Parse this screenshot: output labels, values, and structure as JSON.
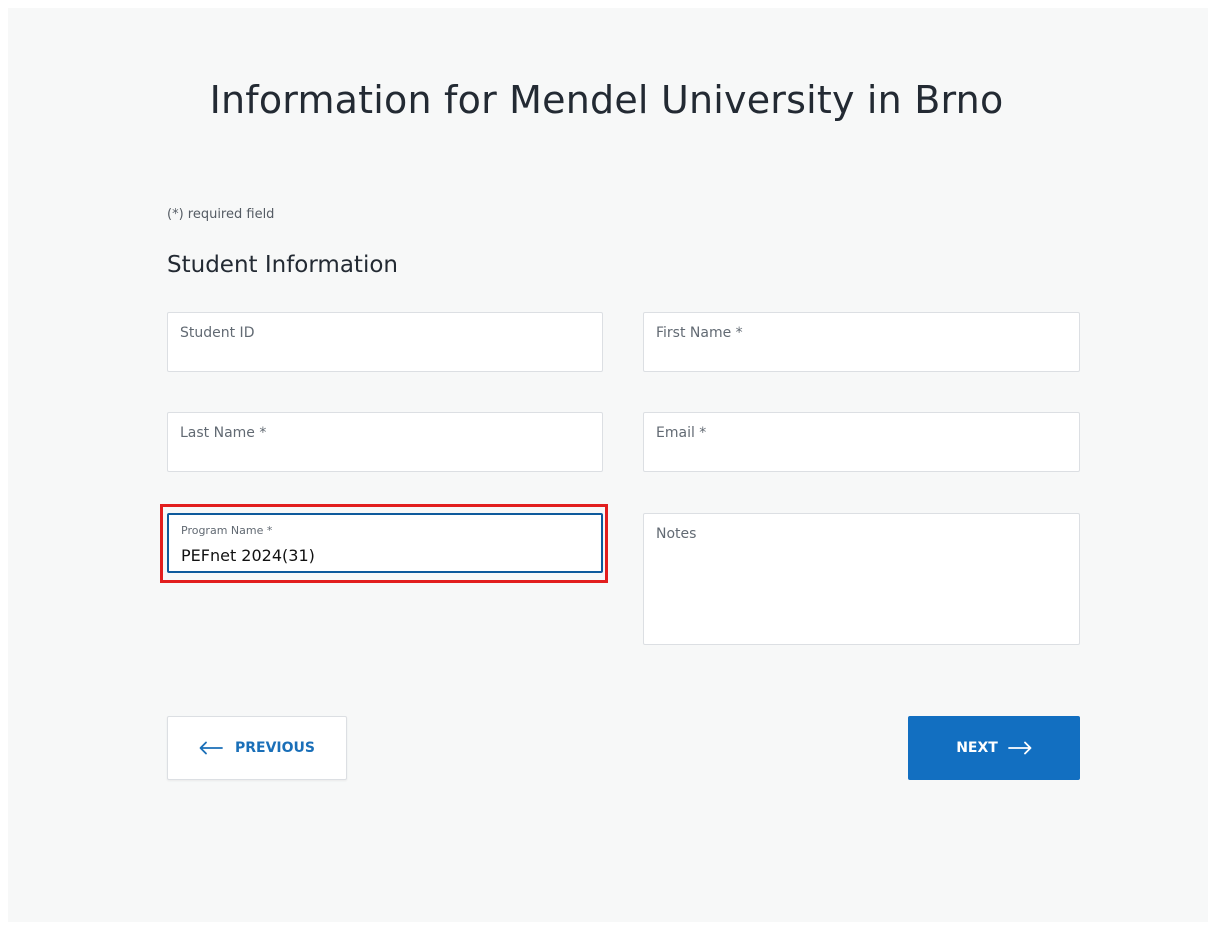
{
  "page": {
    "title": "Information for Mendel University in Brno",
    "required_note": "(*) required field",
    "section_title": "Student Information"
  },
  "fields": {
    "student_id": {
      "label": "Student ID",
      "value": ""
    },
    "first_name": {
      "label": "First Name *",
      "value": ""
    },
    "last_name": {
      "label": "Last Name *",
      "value": ""
    },
    "email": {
      "label": "Email *",
      "value": ""
    },
    "program_name": {
      "label": "Program Name *",
      "value": "PEFnet 2024(31)"
    },
    "notes": {
      "label": "Notes",
      "value": ""
    }
  },
  "buttons": {
    "previous_label": "PREVIOUS",
    "next_label": "NEXT"
  },
  "icons": {
    "previous": "arrow-left-icon",
    "next": "arrow-right-icon"
  },
  "colors": {
    "accent": "#126fc1",
    "highlight": "#e21e1e",
    "focus_border": "#0e5a9c"
  }
}
